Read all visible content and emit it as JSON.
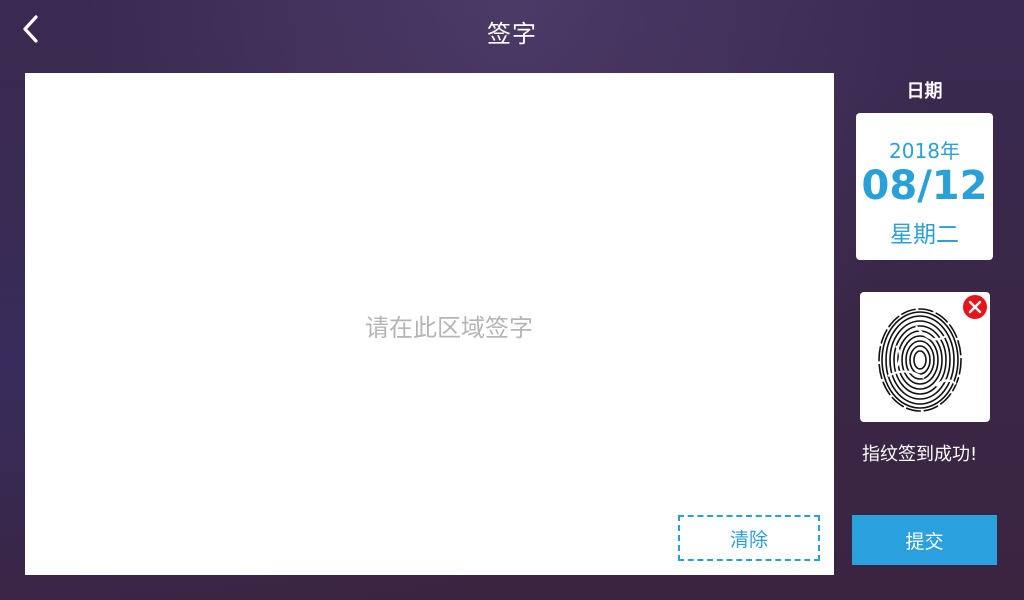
{
  "header": {
    "title": "签字",
    "back_icon": "chevron-left-icon"
  },
  "signature_pad": {
    "placeholder": "请在此区域签字",
    "clear_label": "清除"
  },
  "date_panel": {
    "label": "日期",
    "year": "2018年",
    "day": "08/12",
    "weekday": "星期二"
  },
  "fingerprint": {
    "image_icon": "fingerprint-icon",
    "remove_icon": "close-icon",
    "status": "指纹签到成功!"
  },
  "submit_label": "提交",
  "colors": {
    "accent": "#2aa0de",
    "remove": "#e8141a",
    "background": "#3a2747"
  }
}
